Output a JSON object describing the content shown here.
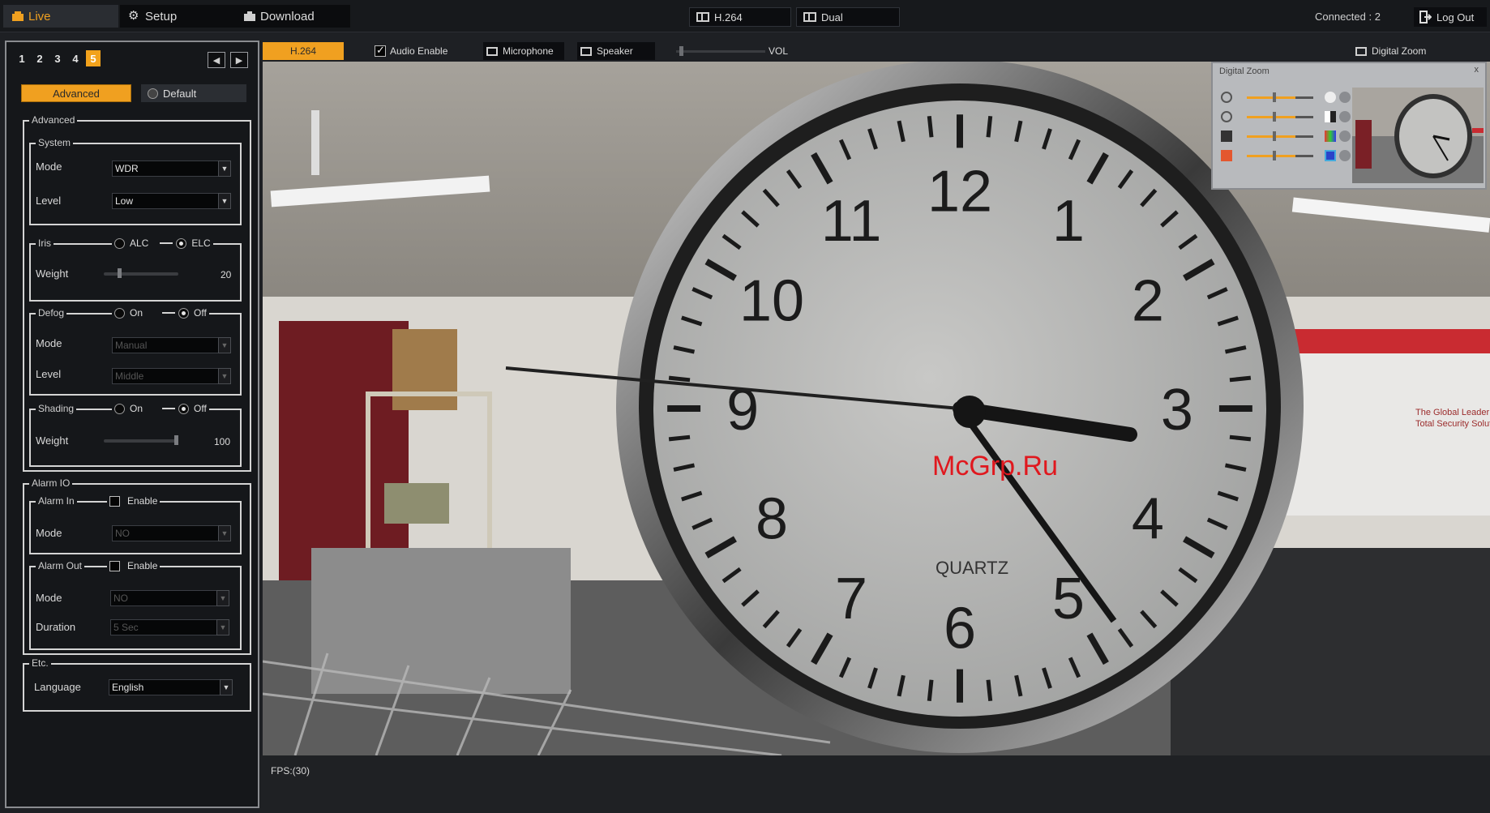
{
  "topbar": {
    "menu": [
      {
        "label": "Live",
        "icon": "live-icon"
      },
      {
        "label": "Setup",
        "icon": "gear-icon"
      },
      {
        "label": "Download",
        "icon": "download-icon"
      }
    ],
    "stream_buttons": [
      {
        "label": "H.264",
        "icon": "window-icon"
      },
      {
        "label": "Dual",
        "icon": "window-icon"
      }
    ],
    "connected": "Connected : 2",
    "logout": "Log Out"
  },
  "left_panel": {
    "num_tabs": [
      "1",
      "2",
      "3",
      "4",
      "5"
    ],
    "active_num_tab": "5",
    "tab_advanced": "Advanced",
    "tab_default": "Default",
    "advanced": {
      "title": "Advanced",
      "system": {
        "title": "System",
        "mode_label": "Mode",
        "mode_value": "WDR",
        "level_label": "Level",
        "level_value": "Low"
      },
      "iris": {
        "title": "Iris",
        "opt1": "ALC",
        "opt2": "ELC",
        "selected": "ELC",
        "weight_label": "Weight",
        "weight_value": "20",
        "weight_fraction": 0.2
      },
      "defog": {
        "title": "Defog",
        "opt1": "On",
        "opt2": "Off",
        "selected": "Off",
        "mode_label": "Mode",
        "mode_value": "Manual",
        "level_label": "Level",
        "level_value": "Middle"
      },
      "shading": {
        "title": "Shading",
        "opt1": "On",
        "opt2": "Off",
        "selected": "Off",
        "weight_label": "Weight",
        "weight_value": "100",
        "weight_fraction": 1.0
      }
    },
    "alarm_io": {
      "title": "Alarm IO",
      "alarm_in": {
        "title": "Alarm In",
        "enable": "Enable",
        "mode_label": "Mode",
        "mode_value": "NO"
      },
      "alarm_out": {
        "title": "Alarm Out",
        "enable": "Enable",
        "mode_label": "Mode",
        "mode_value": "NO",
        "duration_label": "Duration",
        "duration_value": "5 Sec"
      }
    },
    "etc": {
      "title": "Etc.",
      "language_label": "Language",
      "language_value": "English"
    }
  },
  "video_toolbar": {
    "codec": "H.264",
    "audio_enable": "Audio Enable",
    "microphone": "Microphone",
    "speaker": "Speaker",
    "vol": "VOL",
    "digital_zoom": "Digital Zoom"
  },
  "video": {
    "clock_numbers": [
      "12",
      "1",
      "2",
      "3",
      "4",
      "5",
      "6",
      "7",
      "8",
      "9",
      "10",
      "11"
    ],
    "clock_brand": "QUARTZ",
    "wall_sign": "The Global Leader of Total Security Solution",
    "watermark": "McGrp.Ru"
  },
  "digital_zoom_panel": {
    "title": "Digital Zoom",
    "close": "x"
  },
  "status": {
    "fps": "FPS:(30)"
  },
  "colors": {
    "accent": "#f0a020",
    "panel_bg": "#15171a",
    "topbar_bg": "#17191c"
  }
}
